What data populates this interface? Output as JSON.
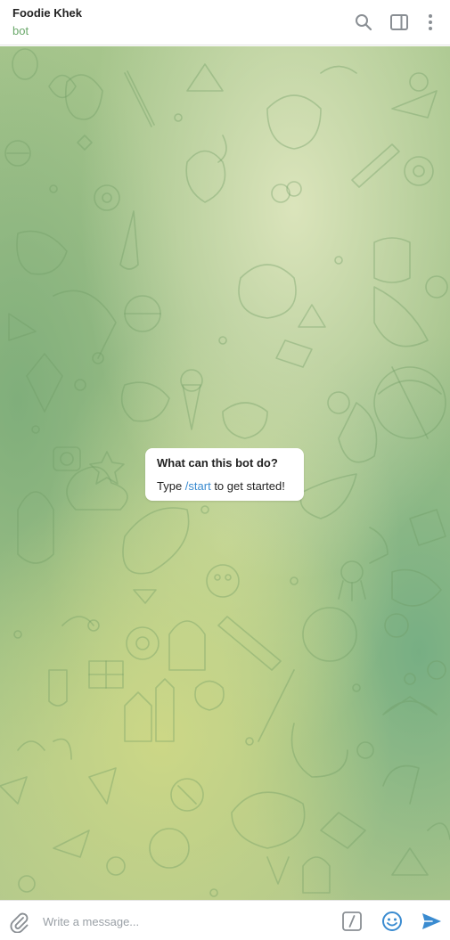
{
  "header": {
    "title": "Foodie Khek",
    "subtitle": "bot",
    "icons": [
      "search-icon",
      "side-panel-icon",
      "more-vertical-icon"
    ]
  },
  "chat": {
    "bot_info": {
      "title": "What can this bot do?",
      "text_before": "Type ",
      "command": "/start",
      "text_after": " to get started!"
    }
  },
  "composer": {
    "placeholder": "Write a message...",
    "icons": [
      "attach-icon",
      "bot-command-icon",
      "emoji-icon",
      "send-icon"
    ]
  },
  "colors": {
    "accent": "#3a8bd0",
    "subtitle": "#6aa86a",
    "icon_grey": "#8a8f94"
  }
}
